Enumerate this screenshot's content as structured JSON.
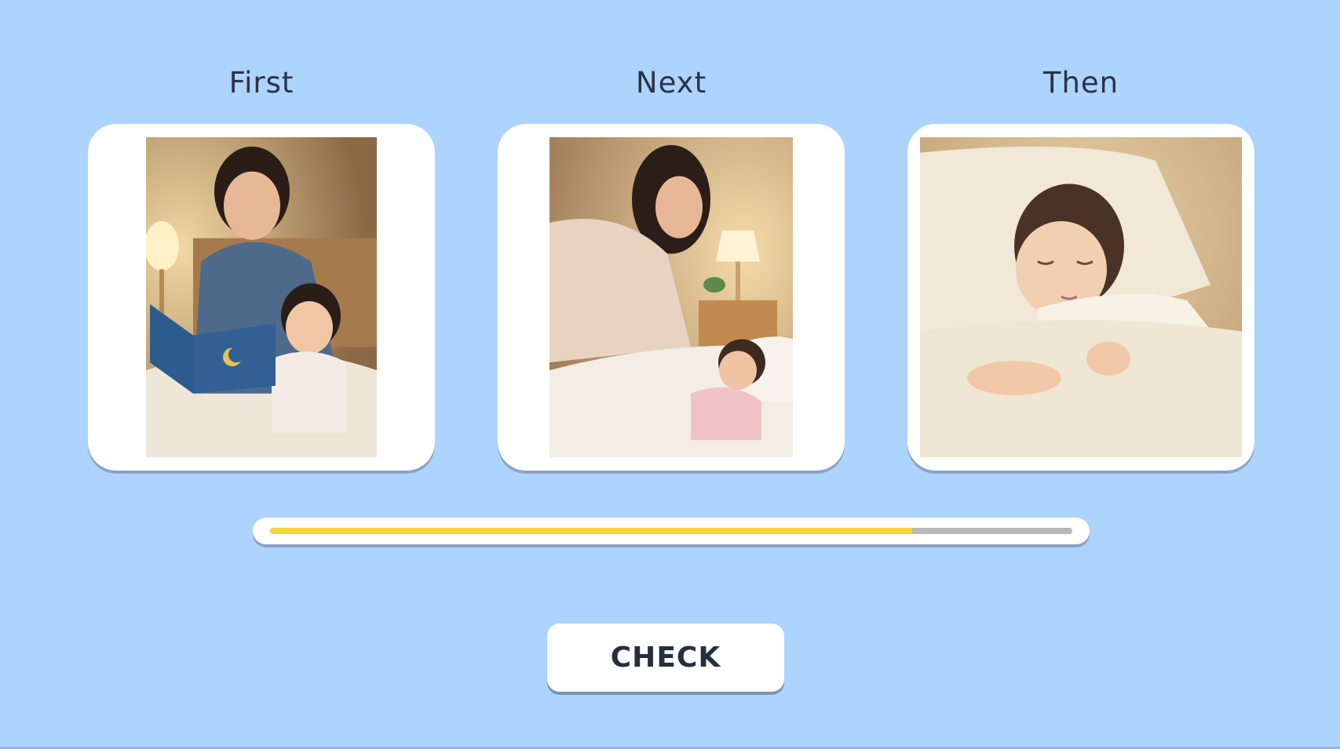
{
  "slots": [
    {
      "label": "First"
    },
    {
      "label": "Next"
    },
    {
      "label": "Then"
    }
  ],
  "cards": [
    {
      "icon": "photo-reading-bedtime-story"
    },
    {
      "icon": "photo-tucking-child-into-bed"
    },
    {
      "icon": "photo-child-sleeping"
    }
  ],
  "progress": {
    "fraction": 0.8
  },
  "check_button": {
    "label": "CHECK"
  },
  "colors": {
    "background": "#add3ff",
    "card": "#ffffff",
    "progress_fill": "#f5d53a",
    "progress_rail": "#b8b8b8",
    "text": "#2a3346"
  }
}
